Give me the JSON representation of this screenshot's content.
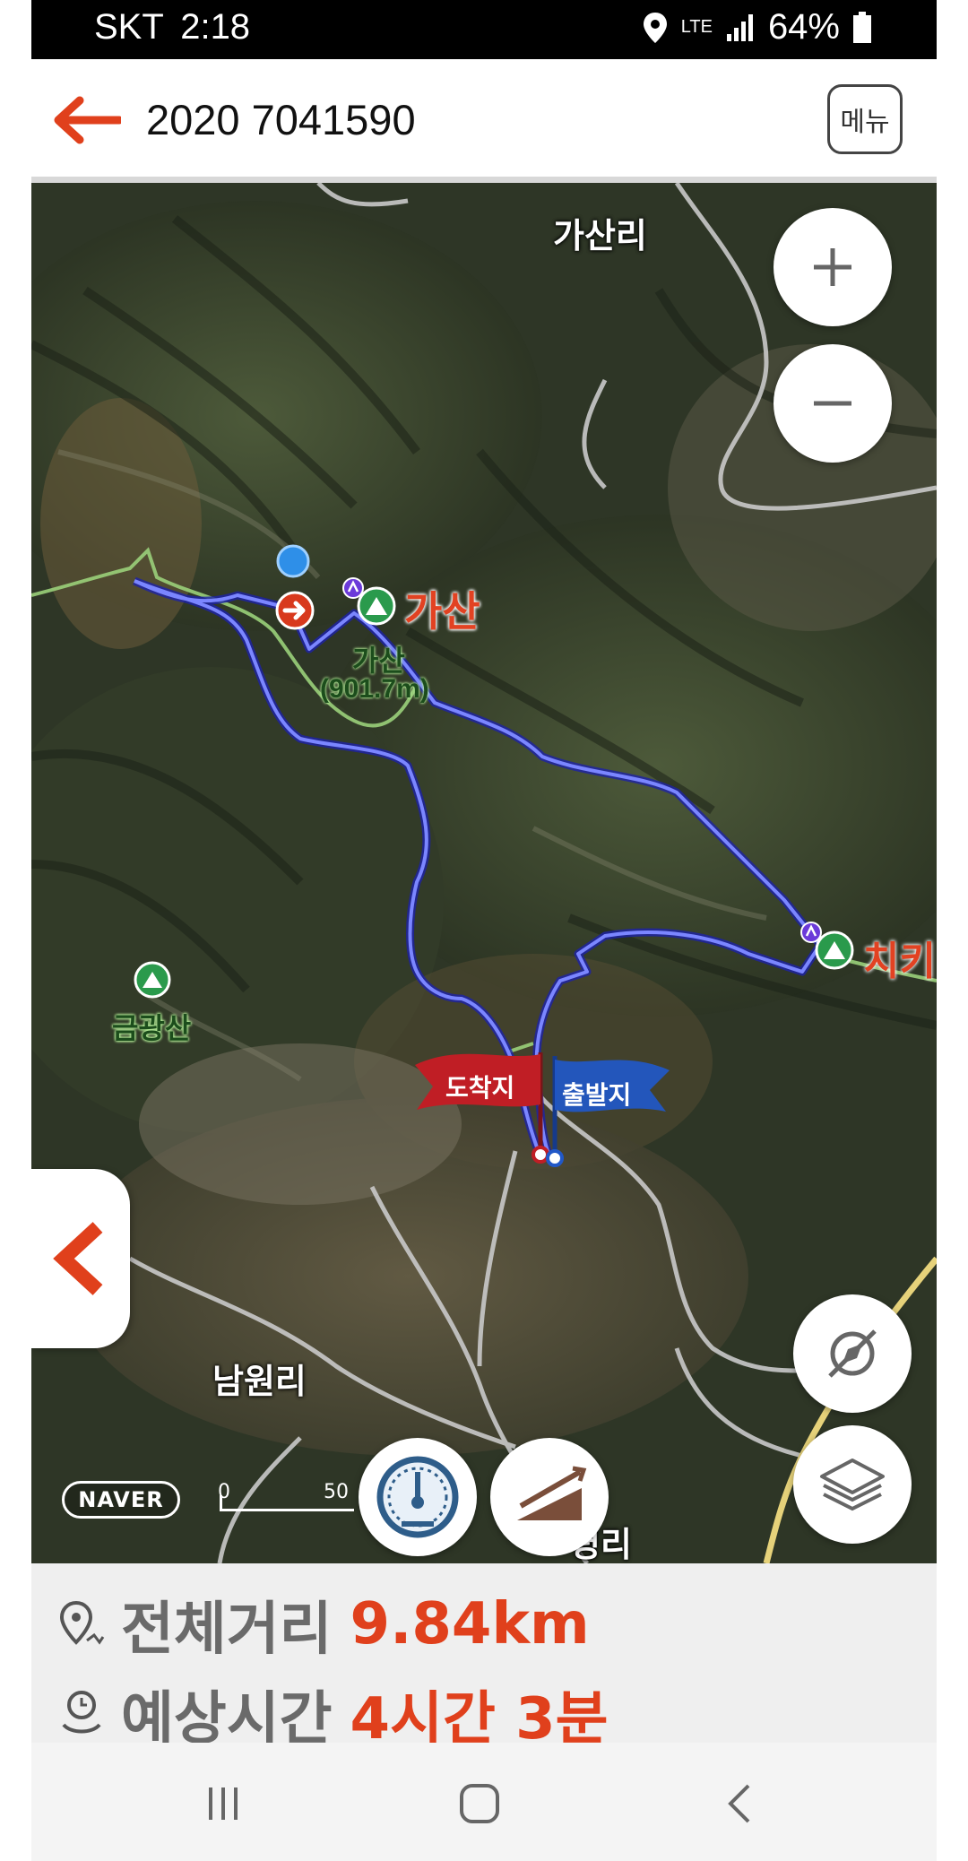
{
  "status_bar": {
    "carrier": "SKT",
    "time": "2:18",
    "network": "LTE",
    "battery": "64%"
  },
  "app_bar": {
    "title": "2020 7041590",
    "menu_label": "메뉴"
  },
  "map": {
    "labels": {
      "village_top": "가산리",
      "peak_main": "가산",
      "peak_main_sub": "가산",
      "peak_main_elev": "(901.7m)",
      "peak_right": "치키",
      "peak_left": "금광산",
      "village_bottom_left": "남원리",
      "village_bottom": "평리"
    },
    "flags": {
      "arrival": "도착지",
      "departure": "출발지"
    },
    "brand": "NAVER",
    "scale": {
      "zero": "0",
      "value": "50"
    }
  },
  "route_info": {
    "distance_label": "전체거리",
    "distance_value": "9.84km",
    "time_label": "예상시간",
    "time_value": "4시간 3분"
  },
  "colors": {
    "accent": "#e0401c",
    "route": "#3a3df0"
  }
}
